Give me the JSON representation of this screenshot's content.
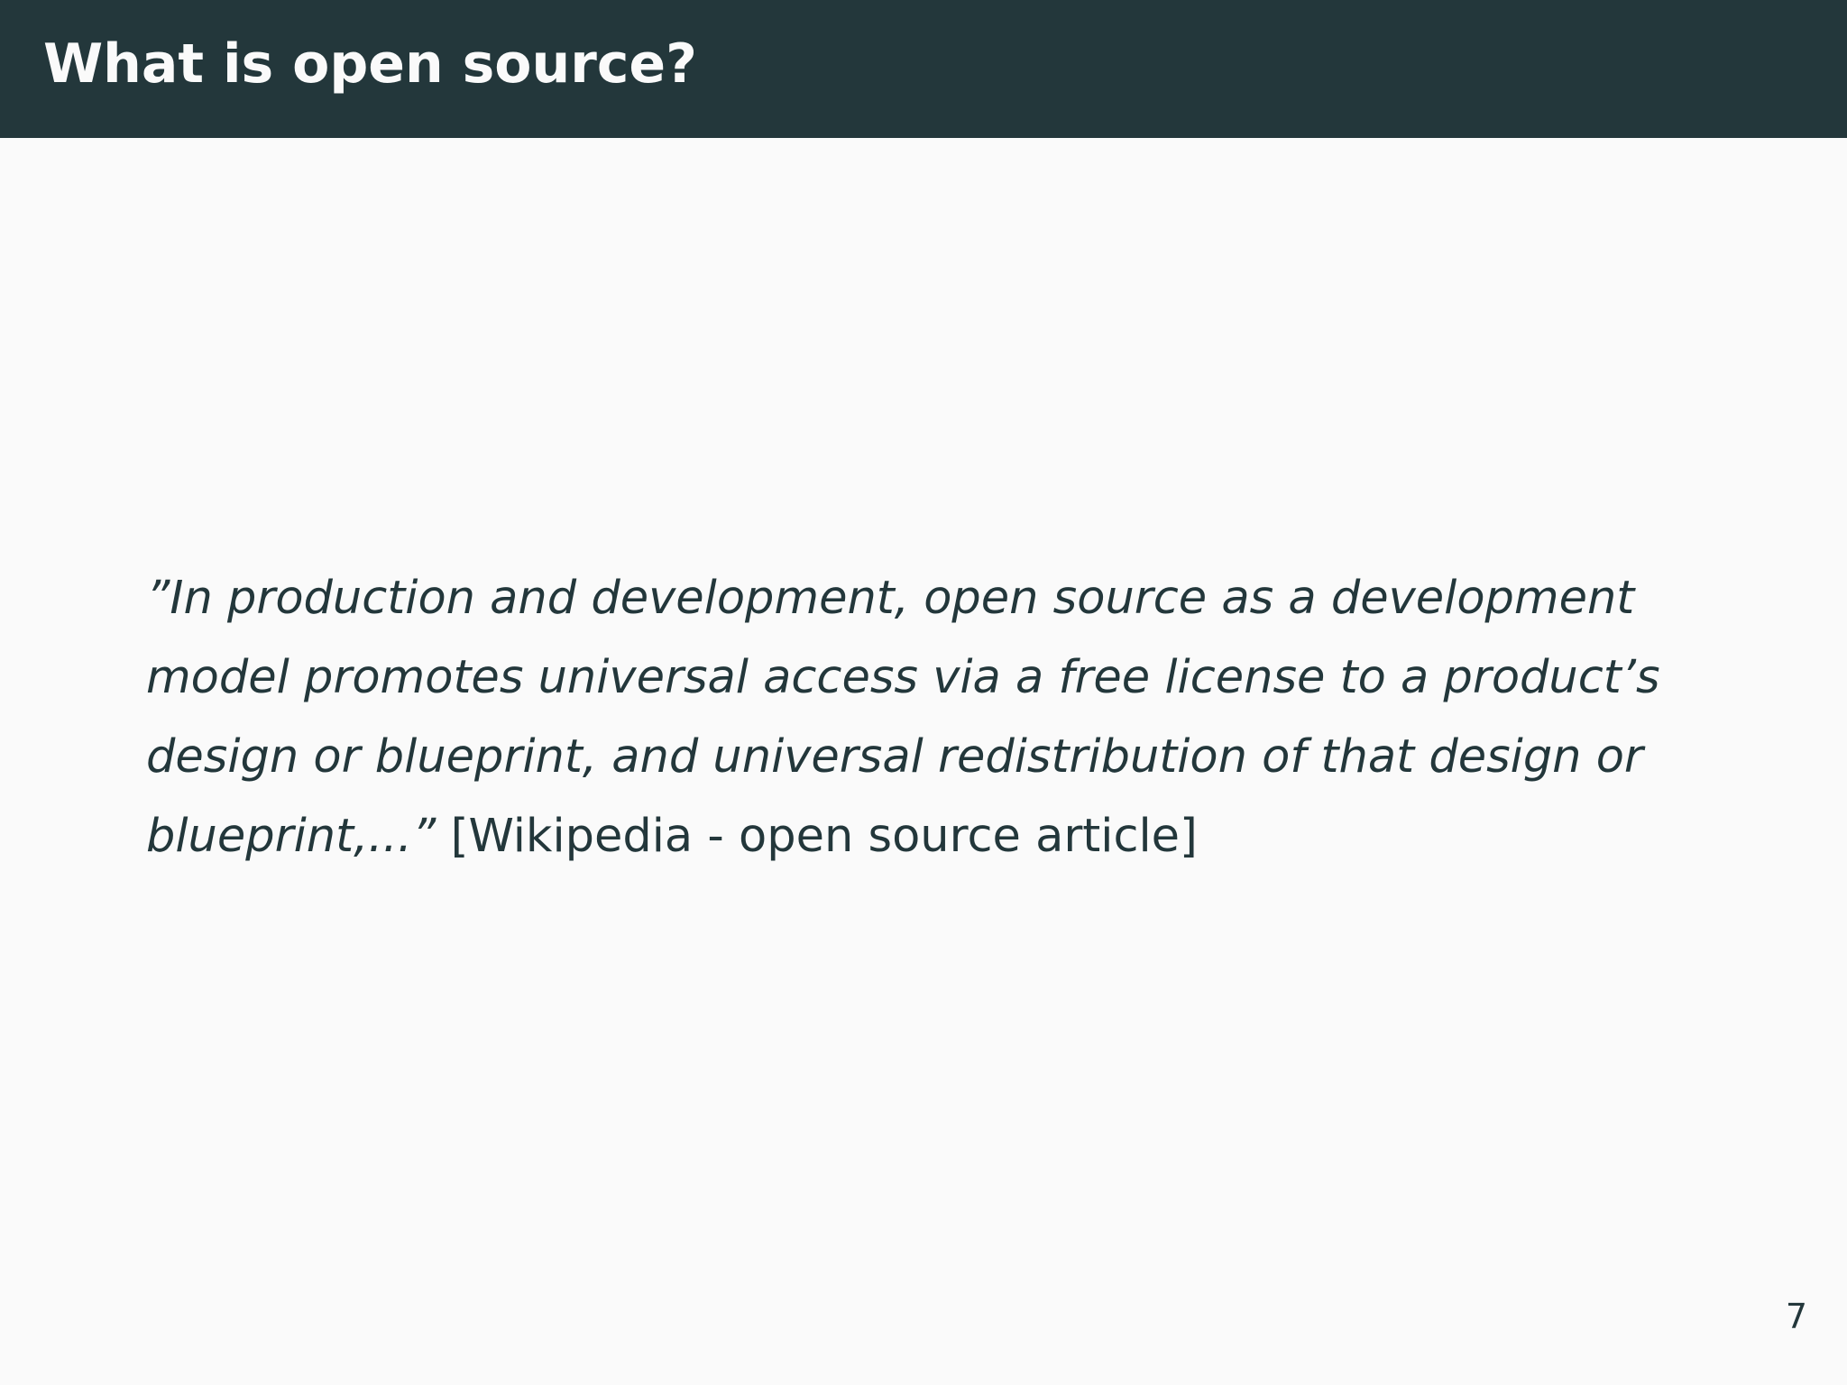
{
  "slide": {
    "title": "What is open source?",
    "quote": "”In production and development, open source as a development model promotes universal access via a free license to a product’s design or blueprint, and universal redistribution of that design or blueprint,...”",
    "citation": "[Wikipedia - open source article]",
    "page_number": "7"
  },
  "colors": {
    "title_bar": "#23373b",
    "background": "#fafafa",
    "text": "#23373b",
    "title_text": "#fafafa"
  }
}
